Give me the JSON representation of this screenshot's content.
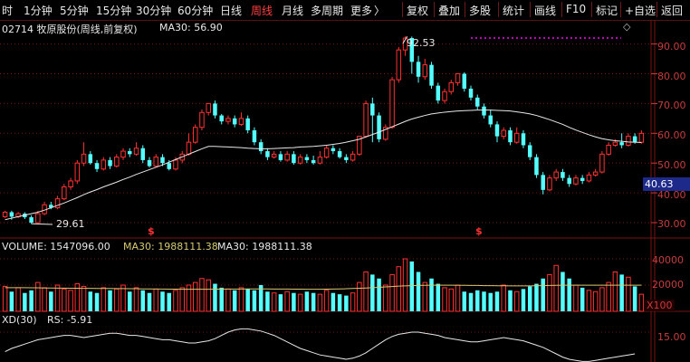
{
  "toolbar": {
    "items": [
      "时",
      "1分钟",
      "5分钟",
      "15分钟",
      "30分钟",
      "60分钟",
      "日线",
      "周线",
      "月线",
      "多周期",
      "更多"
    ],
    "more_icon": "chevron-right-icon",
    "right_items": [
      "复权",
      "叠加",
      "多股",
      "统计",
      "画线",
      "F10",
      "标记",
      "+自选",
      "返回"
    ],
    "active": "周线"
  },
  "main_panel": {
    "stock_label": "02714 牧原股份(周线,前复权)",
    "indicator_label": "MA30: 56.90",
    "high_annotation": "92.53",
    "low_annotation": "29.61",
    "price_ticks": [
      "90.00",
      "80.00",
      "70.00",
      "60.00",
      "50.00",
      "40.00",
      "30.00"
    ],
    "current_price": "40.63",
    "event_marker": "$",
    "options_icon": "diamond-icon"
  },
  "volume_panel": {
    "label": "VOLUME: 1547096.00",
    "ma_label1": "MA30: 1988111.38",
    "ma_label2": "MA30: 1988111.38",
    "ticks": [
      "40000",
      "20000"
    ],
    "unit": "X100"
  },
  "xd_panel": {
    "label": "XD(30)",
    "rs_label": "RS: -5.91",
    "tick": "15.00"
  },
  "colors": {
    "up": "#ff3232",
    "down": "#54ffff",
    "ma": "#e8e8e8",
    "grid": "#7a1414",
    "axis_text": "#c83c3c",
    "price_box": "#1d2a8a",
    "volume_ma": "#d8c870"
  },
  "chart_data": {
    "type": "candlestick",
    "title": "02714 牧原股份(周线,前复权)",
    "price_ylim": [
      25,
      95
    ],
    "candles": [
      [
        32,
        33.5,
        31.5,
        34
      ],
      [
        33.5,
        32,
        31,
        34
      ],
      [
        32,
        33,
        31.5,
        33.6
      ],
      [
        33,
        31.8,
        31.2,
        33.5
      ],
      [
        31.8,
        30,
        29.61,
        32.5
      ],
      [
        30,
        33,
        29.8,
        34
      ],
      [
        33,
        36,
        32.5,
        37
      ],
      [
        36,
        35,
        34.5,
        37
      ],
      [
        35,
        38,
        34.5,
        39
      ],
      [
        38,
        42,
        37.5,
        43
      ],
      [
        42,
        44,
        41,
        45
      ],
      [
        44,
        50,
        43,
        51
      ],
      [
        50,
        53,
        49,
        57
      ],
      [
        53,
        50,
        49.5,
        54
      ],
      [
        50,
        48,
        47,
        51
      ],
      [
        48,
        51,
        47.5,
        52
      ],
      [
        51,
        49,
        48,
        52
      ],
      [
        49,
        52,
        48.5,
        53
      ],
      [
        52,
        54,
        51,
        55
      ],
      [
        54,
        53,
        52,
        55
      ],
      [
        53,
        55,
        52.5,
        57
      ],
      [
        55,
        51,
        50,
        56
      ],
      [
        51,
        49,
        48.5,
        52
      ],
      [
        49,
        52,
        48.5,
        53
      ],
      [
        52,
        50,
        49,
        53
      ],
      [
        50,
        48,
        47.5,
        51
      ],
      [
        48,
        51,
        47.5,
        52
      ],
      [
        51,
        53,
        50,
        54
      ],
      [
        53,
        57,
        52.5,
        60
      ],
      [
        57,
        62,
        56.5,
        63
      ],
      [
        62,
        67,
        61,
        68
      ],
      [
        67,
        70,
        66,
        70
      ],
      [
        70,
        66,
        65,
        71
      ],
      [
        66,
        64,
        63,
        66.5
      ],
      [
        64,
        65,
        63,
        66
      ],
      [
        65,
        63,
        62,
        66
      ],
      [
        63,
        65,
        62.5,
        67
      ],
      [
        65,
        61,
        60,
        66
      ],
      [
        61,
        57,
        56,
        62
      ],
      [
        57,
        54,
        53,
        58
      ],
      [
        54,
        52,
        51,
        55
      ],
      [
        52,
        53,
        51.5,
        54
      ],
      [
        53,
        51,
        50.5,
        54
      ],
      [
        51,
        53,
        50.5,
        54
      ],
      [
        53,
        50,
        49.5,
        54
      ],
      [
        50,
        52,
        49.5,
        53
      ],
      [
        52,
        51,
        50,
        53
      ],
      [
        51,
        50,
        49.5,
        52.5
      ],
      [
        50,
        52,
        49.5,
        54
      ],
      [
        52,
        55,
        51.5,
        56
      ],
      [
        55,
        54,
        53,
        56
      ],
      [
        54,
        52,
        51.5,
        55
      ],
      [
        52,
        51,
        50,
        53
      ],
      [
        51,
        53,
        50.5,
        54
      ],
      [
        53,
        59,
        52.5,
        59
      ],
      [
        59,
        70,
        58.5,
        71
      ],
      [
        70,
        66,
        57,
        72
      ],
      [
        66,
        58,
        57,
        67
      ],
      [
        58,
        62,
        57.5,
        63
      ],
      [
        62,
        78,
        61.5,
        79
      ],
      [
        78,
        88,
        77,
        89
      ],
      [
        88,
        92,
        86,
        92.53
      ],
      [
        92,
        84,
        80,
        92.5
      ],
      [
        84,
        79,
        77,
        86
      ],
      [
        79,
        83,
        78,
        85
      ],
      [
        83,
        76,
        75,
        84
      ],
      [
        76,
        71,
        70,
        77
      ],
      [
        71,
        74,
        70,
        75
      ],
      [
        74,
        77,
        73,
        78
      ],
      [
        77,
        80,
        76,
        80
      ],
      [
        80,
        75,
        74,
        80.5
      ],
      [
        75,
        72,
        71,
        76
      ],
      [
        72,
        69,
        68,
        73
      ],
      [
        69,
        66,
        65,
        70
      ],
      [
        66,
        63,
        62,
        68
      ],
      [
        63,
        59,
        57,
        64
      ],
      [
        59,
        61,
        58,
        62
      ],
      [
        61,
        57,
        56,
        62
      ],
      [
        57,
        60,
        56.5,
        62
      ],
      [
        60,
        56,
        55,
        61
      ],
      [
        56,
        52,
        51,
        57
      ],
      [
        52,
        46,
        45,
        53
      ],
      [
        46,
        41,
        39.5,
        47
      ],
      [
        41,
        45,
        40.5,
        46
      ],
      [
        45,
        47,
        44,
        48
      ],
      [
        47,
        45,
        44,
        48
      ],
      [
        45,
        43,
        42,
        46
      ],
      [
        43,
        45,
        42.5,
        46
      ],
      [
        45,
        44,
        43,
        46
      ],
      [
        44,
        46,
        43.5,
        47
      ],
      [
        46,
        47,
        45.5,
        48
      ],
      [
        47,
        53,
        46.5,
        54
      ],
      [
        53,
        56,
        52.5,
        57
      ],
      [
        56,
        57,
        55.5,
        58
      ],
      [
        57,
        56,
        55,
        60
      ],
      [
        56,
        59,
        55.5,
        60
      ],
      [
        59,
        57,
        56.5,
        60
      ],
      [
        57,
        60,
        56.5,
        61
      ]
    ],
    "ma30": [
      31,
      31.5,
      32,
      32.5,
      33,
      33.5,
      34.2,
      35,
      35.8,
      36.6,
      37.5,
      38.4,
      39.4,
      40.3,
      41.1,
      42,
      42.8,
      43.6,
      44.5,
      45.3,
      46.2,
      47,
      47.8,
      48.6,
      49.4,
      50.3,
      51.2,
      52.1,
      53,
      53.9,
      54.8,
      55.6,
      55.6,
      55.5,
      55.4,
      55.3,
      55.2,
      55,
      54.9,
      54.8,
      54.8,
      54.9,
      55,
      55.1,
      55.2,
      55.4,
      55.5,
      55.6,
      55.8,
      56,
      56.3,
      56.6,
      57,
      57.5,
      58,
      58.8,
      59.6,
      60.4,
      61.3,
      62.2,
      63.1,
      64,
      64.8,
      65.4,
      66,
      66.5,
      66.8,
      67.1,
      67.3,
      67.5,
      67.6,
      67.7,
      67.8,
      67.8,
      67.8,
      67.7,
      67.6,
      67.5,
      67.2,
      66.9,
      66.5,
      66,
      65.3,
      64.6,
      63.8,
      63,
      62,
      61.1,
      60.3,
      59.5,
      58.8,
      58.2,
      57.8,
      57.5,
      57.3,
      57.1,
      57,
      56.9
    ],
    "volume_ylim": [
      0,
      50000
    ],
    "volume": [
      19000,
      15000,
      18000,
      14000,
      16000,
      22000,
      18000,
      15000,
      20000,
      17000,
      16000,
      21000,
      19000,
      15000,
      14000,
      18000,
      16000,
      17000,
      20000,
      15000,
      18000,
      16000,
      14000,
      17000,
      15000,
      14000,
      16000,
      18000,
      20000,
      22000,
      25000,
      24000,
      21000,
      18000,
      17000,
      16000,
      18000,
      17000,
      16000,
      20000,
      15000,
      14000,
      13000,
      15000,
      14000,
      13000,
      15000,
      14000,
      13000,
      16000,
      14000,
      13000,
      12000,
      14000,
      22000,
      30000,
      28000,
      25000,
      20000,
      28000,
      34000,
      40000,
      38000,
      30000,
      22000,
      25000,
      21000,
      18000,
      17000,
      20000,
      15000,
      14000,
      16000,
      15000,
      14000,
      15000,
      20000,
      16000,
      15000,
      17000,
      19000,
      21000,
      25000,
      28000,
      35000,
      30000,
      25000,
      20000,
      18000,
      16000,
      15000,
      18000,
      22000,
      30000,
      28000,
      26000,
      19000,
      13000
    ],
    "volume_ma30": [
      18000,
      18000,
      18000,
      18000,
      17900,
      17900,
      17800,
      17800,
      17700,
      17700,
      17600,
      17600,
      17500,
      17500,
      17400,
      17400,
      17400,
      17300,
      17300,
      17200,
      17200,
      17100,
      17100,
      17000,
      17000,
      16900,
      16900,
      16800,
      16800,
      16800,
      16800,
      16800,
      16900,
      16900,
      17000,
      17000,
      17000,
      17100,
      17100,
      17100,
      17100,
      17000,
      17000,
      17000,
      16900,
      16900,
      16800,
      16800,
      16800,
      16900,
      17000,
      17100,
      17200,
      17400,
      17600,
      17800,
      18000,
      18300,
      18600,
      18900,
      19200,
      19400,
      19600,
      19700,
      19800,
      19900,
      19900,
      19900,
      19900,
      19800,
      19800,
      19700,
      19700,
      19600,
      19600,
      19500,
      19500,
      19400,
      19400,
      19400,
      19400,
      19500,
      19600,
      19700,
      19800,
      19900,
      19900,
      19900,
      19900,
      19900,
      19900,
      19900,
      19900,
      19900,
      19900,
      19900,
      19900,
      19900
    ],
    "xd_ylim": [
      -30,
      20
    ],
    "xd": [
      -3,
      0,
      2,
      4,
      6,
      8,
      9,
      10,
      11,
      12,
      12,
      11,
      10,
      11,
      12,
      13,
      14,
      14,
      13,
      12,
      12,
      11,
      10,
      9,
      8,
      8,
      7,
      6,
      5,
      5,
      6,
      7,
      9,
      12,
      15,
      17,
      18,
      18,
      17,
      16,
      14,
      12,
      9,
      6,
      3,
      0,
      -2,
      -4,
      -6,
      -7,
      -8,
      -9,
      -10,
      -9,
      -7,
      -4,
      0,
      4,
      8,
      11,
      13,
      14,
      15,
      15,
      14,
      13,
      12,
      10,
      9,
      8,
      7,
      6,
      6,
      7,
      8,
      9,
      10,
      9,
      8,
      7,
      5,
      3,
      1,
      -2,
      -5,
      -8,
      -10,
      -11,
      -12,
      -12,
      -11,
      -10,
      -9,
      -8,
      -7,
      -6,
      -5
    ]
  }
}
